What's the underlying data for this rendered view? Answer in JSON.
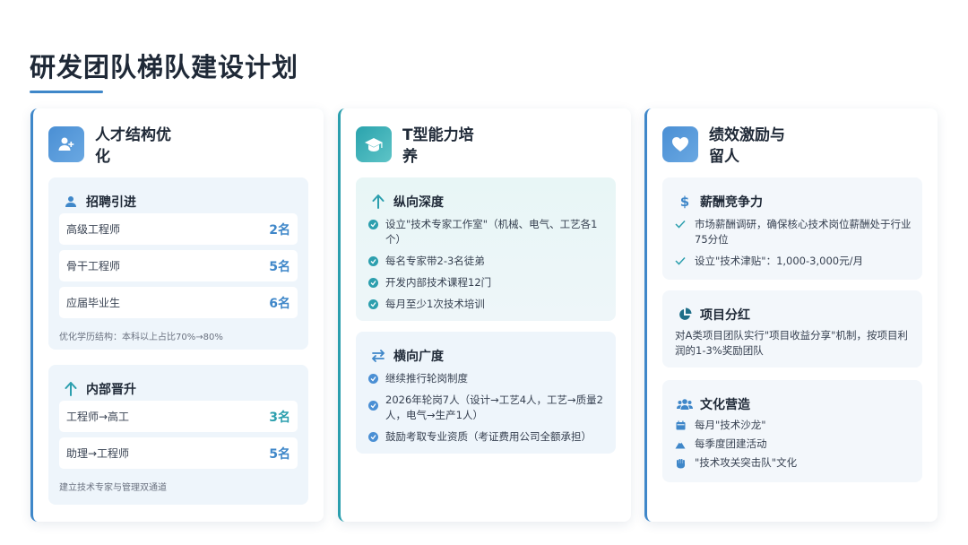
{
  "page": {
    "title": "研发团队梯队建设计划"
  },
  "colors": {
    "accent_blue": "#3f87c9",
    "accent_teal": "#2c9fae"
  },
  "cards": [
    {
      "title": "人才结构优化",
      "icon": "user-add-icon",
      "sections": [
        {
          "title": "招聘引进",
          "icon": "user-icon",
          "rows": [
            {
              "label": "高级工程师",
              "count": "2名"
            },
            {
              "label": "骨干工程师",
              "count": "5名"
            },
            {
              "label": "应届毕业生",
              "count": "6名"
            }
          ],
          "note": "优化学历结构：本科以上占比70%→80%"
        },
        {
          "title": "内部晋升",
          "icon": "arrow-up-icon",
          "rows": [
            {
              "label": "工程师→高工",
              "count": "3名"
            },
            {
              "label": "助理→工程师",
              "count": "5名"
            }
          ],
          "note": "建立技术专家与管理双通道"
        }
      ]
    },
    {
      "title": "T型能力培养",
      "icon": "graduation-cap-icon",
      "sections": [
        {
          "title": "纵向深度",
          "icon": "arrow-up-icon",
          "bullets": [
            "设立\"技术专家工作室\"（机械、电气、工艺各1个）",
            "每名专家带2-3名徒弟",
            "开发内部技术课程12门",
            "每月至少1次技术培训"
          ]
        },
        {
          "title": "横向广度",
          "icon": "exchange-icon",
          "bullets": [
            "继续推行轮岗制度",
            "2026年轮岗7人（设计→工艺4人，工艺→质量2人，电气→生产1人）",
            "鼓励考取专业资质（考证费用公司全额承担）"
          ]
        }
      ]
    },
    {
      "title": "绩效激励与留人",
      "icon": "heart-icon",
      "sections": [
        {
          "title": "薪酬竞争力",
          "icon": "dollar-icon",
          "checks": [
            "市场薪酬调研，确保核心技术岗位薪酬处于行业75分位",
            "设立\"技术津贴\"：1,000-3,000元/月"
          ]
        },
        {
          "title": "项目分红",
          "icon": "pie-chart-icon",
          "text": "对A类项目团队实行\"项目收益分享\"机制，按项目利润的1-3%奖励团队"
        },
        {
          "title": "文化营造",
          "icon": "users-icon",
          "items": [
            {
              "icon": "calendar-icon",
              "text": "每月\"技术沙龙\""
            },
            {
              "icon": "mountain-icon",
              "text": "每季度团建活动"
            },
            {
              "icon": "fist-icon",
              "text": "\"技术攻关突击队\"文化"
            }
          ]
        }
      ]
    }
  ]
}
